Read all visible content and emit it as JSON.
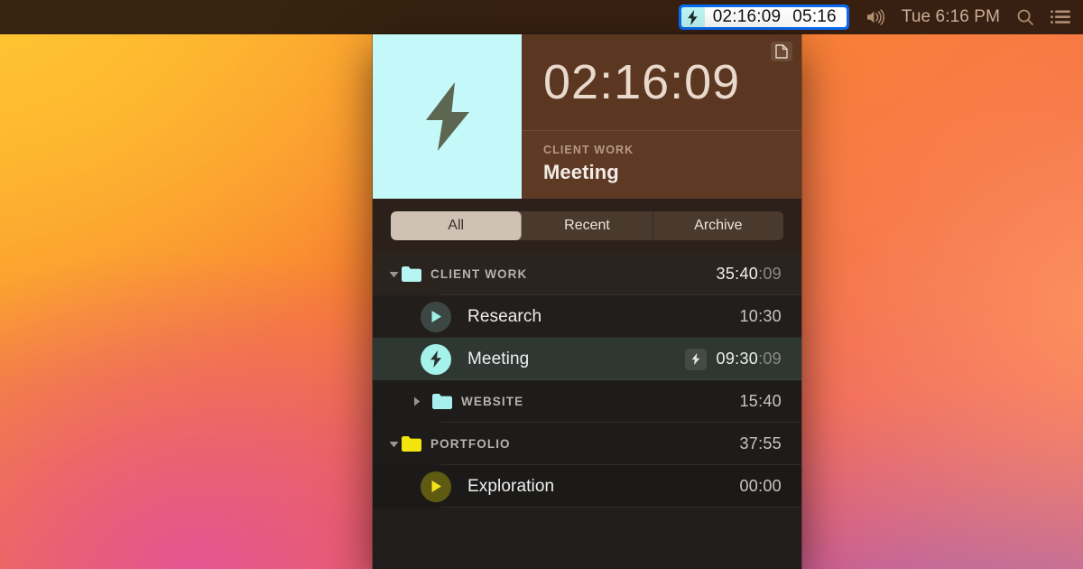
{
  "menubar": {
    "timer_extra": {
      "icon": "bolt-icon",
      "elapsed": "02:16:09",
      "remaining": "05:16"
    },
    "volume_icon": "speaker-volume-icon",
    "clock": "Tue 6:16 PM",
    "search_icon": "search-icon",
    "control_center_icon": "control-center-icon"
  },
  "window": {
    "header": {
      "hero_icon": "bolt-icon",
      "hero_bg": "#c5f8f8",
      "timer": "02:16:09",
      "project": "CLIENT WORK",
      "title": "Meeting",
      "note_icon": "note-document-icon"
    },
    "tabs": {
      "items": [
        {
          "label": "All",
          "active": true
        },
        {
          "label": "Recent",
          "active": false
        },
        {
          "label": "Archive",
          "active": false
        }
      ]
    },
    "list": [
      {
        "kind": "group",
        "name": "CLIENT WORK",
        "folder_color": "#b5f5f2",
        "expanded": true,
        "indent": 0,
        "time_main": "35:40",
        "time_secs": ":09"
      },
      {
        "kind": "task",
        "name": "Research",
        "state": "paused",
        "icon": "play-icon",
        "circle_bg": "#3c4744",
        "icon_color": "#9ff0e6",
        "time_main": "10:30",
        "time_secs": "",
        "selected": false,
        "running_badge": false
      },
      {
        "kind": "task",
        "name": "Meeting",
        "state": "running",
        "icon": "bolt-icon",
        "circle_bg": "#a5f2ea",
        "icon_color": "#2b3330",
        "time_main": "09:30",
        "time_secs": ":09",
        "selected": true,
        "running_badge": true,
        "badge_icon": "bolt-icon"
      },
      {
        "kind": "group",
        "name": "WEBSITE",
        "folder_color": "#a8f0f0",
        "expanded": false,
        "indent": 1,
        "time_main": "15:40",
        "time_secs": ""
      },
      {
        "kind": "group",
        "name": "PORTFOLIO",
        "folder_color": "#f2e40c",
        "expanded": true,
        "indent": 0,
        "time_main": "37:55",
        "time_secs": ""
      },
      {
        "kind": "task",
        "name": "Exploration",
        "state": "paused",
        "icon": "play-icon",
        "circle_bg": "#5e5a12",
        "icon_color": "#f5e31a",
        "time_main": "00:00",
        "time_secs": "",
        "selected": false,
        "running_badge": false
      }
    ]
  },
  "colors": {
    "accent_cyan": "#a5f2ea",
    "accent_yellow": "#f2e40c",
    "header_brown": "#5b3722",
    "selection_blue": "#0a6cf5"
  }
}
